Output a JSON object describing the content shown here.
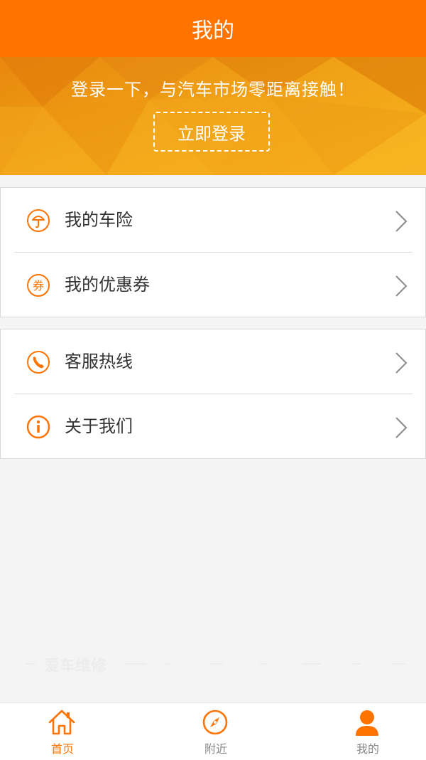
{
  "header": {
    "title": "我的"
  },
  "banner": {
    "slogan": "登录一下，与汽车市场零距离接触！",
    "login_button": "立即登录"
  },
  "menu_groups": [
    {
      "items": [
        {
          "label": "我的车险",
          "icon": "umbrella-icon"
        },
        {
          "label": "我的优惠券",
          "icon": "coupon-icon",
          "icon_text": "券"
        }
      ]
    },
    {
      "items": [
        {
          "label": "客服热线",
          "icon": "phone-icon"
        },
        {
          "label": "关于我们",
          "icon": "info-icon"
        }
      ]
    }
  ],
  "watermark": {
    "text": "爱车维修"
  },
  "tabbar": {
    "tabs": [
      {
        "label": "首页",
        "icon": "home-icon",
        "active": true
      },
      {
        "label": "附近",
        "icon": "compass-icon",
        "active": false
      },
      {
        "label": "我的",
        "icon": "user-icon",
        "active": false
      }
    ]
  },
  "colors": {
    "accent": "#ff7300",
    "text": "#333333",
    "inactive_tab": "#888888",
    "banner": "#f0a016"
  }
}
